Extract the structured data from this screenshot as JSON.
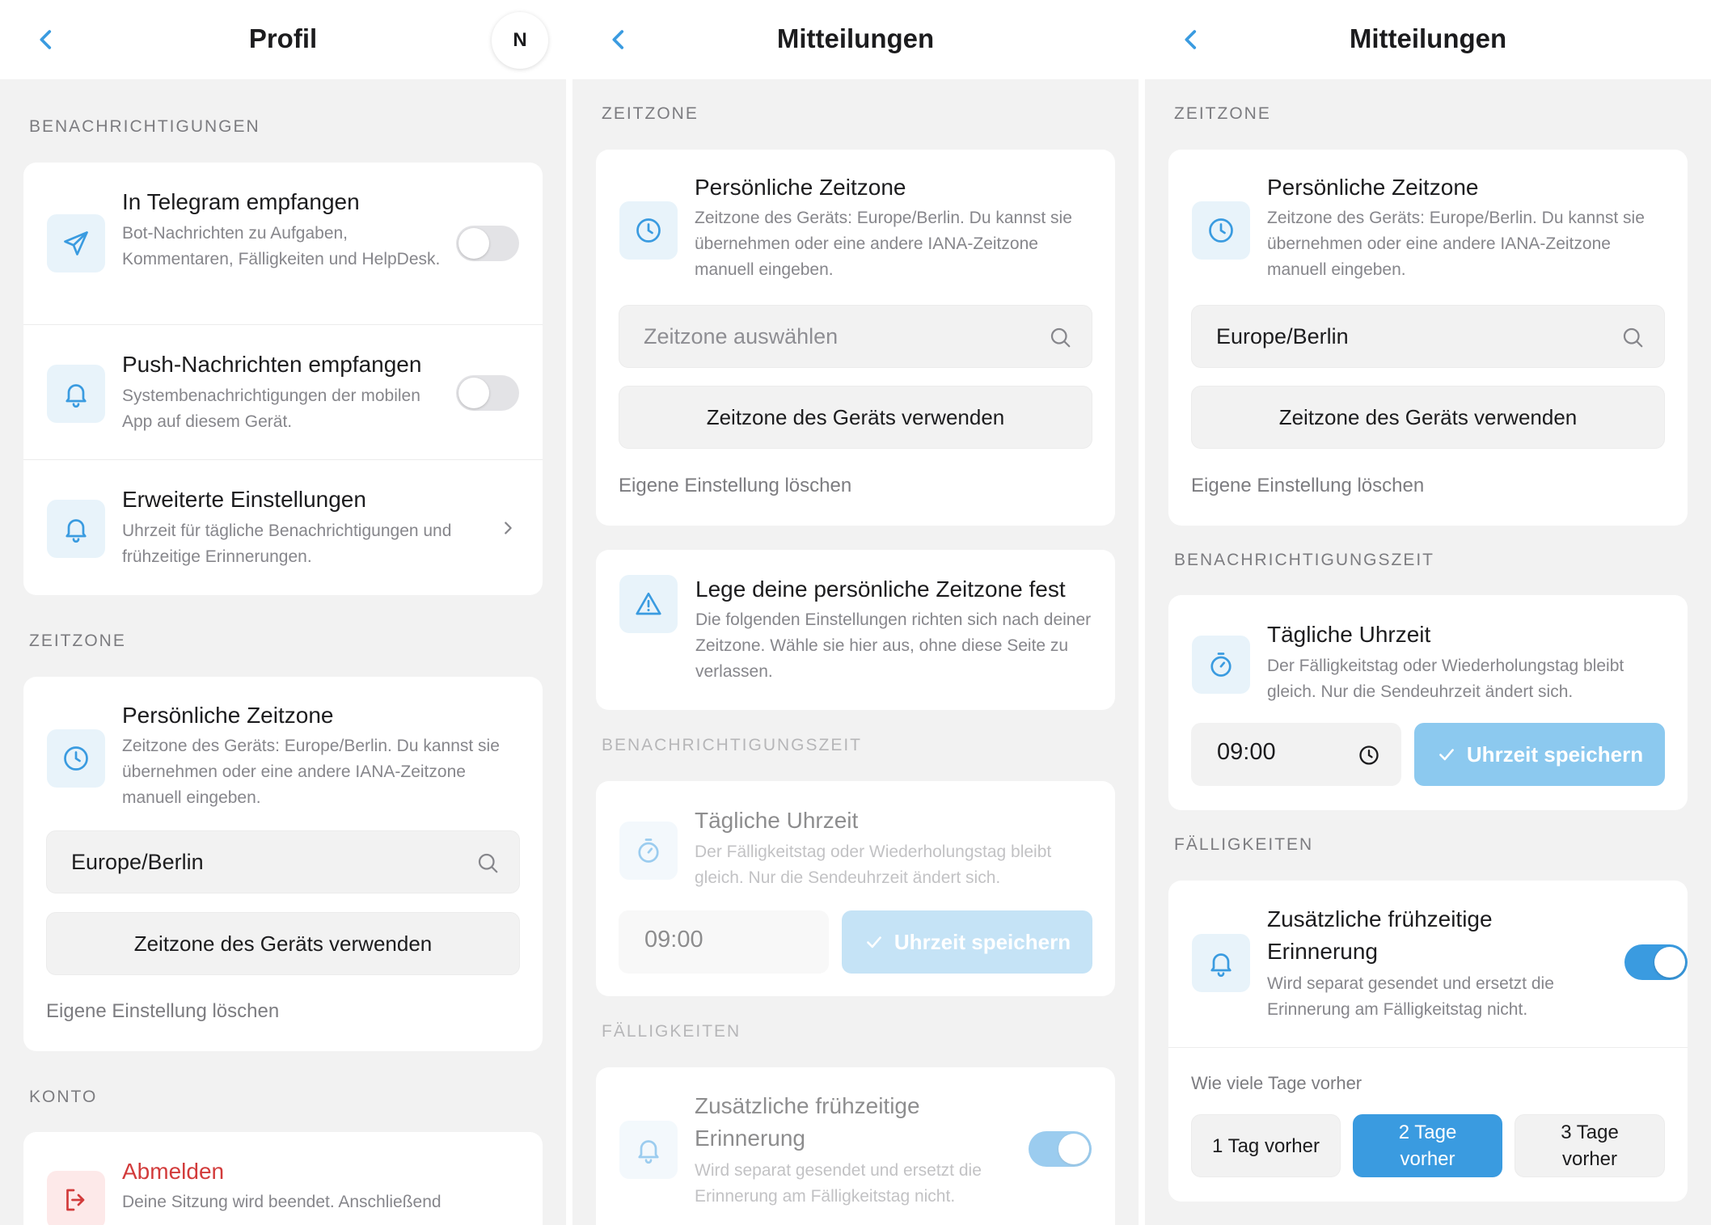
{
  "colors": {
    "accent": "#3a9be0",
    "accent_light": "#8cc9ef",
    "icon_bg": "#e8f3fa",
    "danger": "#d23b3b"
  },
  "panel1": {
    "title": "Profil",
    "avatar_initial": "N",
    "sec_notifications": "BENACHRICHTIGUNGEN",
    "telegram": {
      "title": "In Telegram empfangen",
      "desc": "Bot-Nachrichten zu Aufgaben, Kommentaren, Fälligkeiten und HelpDesk.",
      "icon": "send-icon",
      "enabled": false
    },
    "push": {
      "title": "Push-Nachrichten empfangen",
      "desc": "Systembenachrichtigungen der mobilen App auf diesem Gerät.",
      "icon": "bell-icon",
      "enabled": false
    },
    "advanced": {
      "title": "Erweiterte Einstellungen",
      "desc": "Uhrzeit für tägliche Benachrichtigungen und frühzeitige Erinnerungen.",
      "icon": "bell-icon"
    },
    "sec_timezone": "ZEITZONE",
    "timezone": {
      "title": "Persönliche Zeitzone",
      "desc": "Zeitzone des Geräts: Europe/Berlin. Du kannst sie übernehmen oder eine andere IANA-Zeitzone manuell eingeben.",
      "value": "Europe/Berlin",
      "use_device": "Zeitzone des Geräts verwenden",
      "clear": "Eigene Einstellung löschen"
    },
    "sec_account": "KONTO",
    "logout": {
      "title": "Abmelden",
      "desc": "Deine Sitzung wird beendet. Anschließend"
    }
  },
  "panel2": {
    "title": "Mitteilungen",
    "sec_timezone": "ZEITZONE",
    "timezone": {
      "title": "Persönliche Zeitzone",
      "desc": "Zeitzone des Geräts: Europe/Berlin. Du kannst sie übernehmen oder eine andere IANA-Zeitzone manuell eingeben.",
      "placeholder": "Zeitzone auswählen",
      "use_device": "Zeitzone des Geräts verwenden",
      "clear": "Eigene Einstellung löschen"
    },
    "warning": {
      "title": "Lege deine persönliche Zeitzone fest",
      "desc": "Die folgenden Einstellungen richten sich nach deiner Zeitzone. Wähle sie hier aus, ohne diese Seite zu verlassen."
    },
    "sec_time": "BENACHRICHTIGUNGSZEIT",
    "daily": {
      "title": "Tägliche Uhrzeit",
      "desc": "Der Fälligkeitstag oder Wiederholungstag bleibt gleich. Nur die Sendeuhrzeit ändert sich.",
      "time": "09:00",
      "save": "Uhrzeit speichern"
    },
    "sec_due": "FÄLLIGKEITEN",
    "early": {
      "title": "Zusätzliche frühzeitige Erinnerung",
      "desc": "Wird separat gesendet und ersetzt die Erinnerung am Fälligkeitstag nicht.",
      "enabled": true
    }
  },
  "panel3": {
    "title": "Mitteilungen",
    "sec_timezone": "ZEITZONE",
    "timezone": {
      "title": "Persönliche Zeitzone",
      "desc": "Zeitzone des Geräts: Europe/Berlin. Du kannst sie übernehmen oder eine andere IANA-Zeitzone manuell eingeben.",
      "value": "Europe/Berlin",
      "use_device": "Zeitzone des Geräts verwenden",
      "clear": "Eigene Einstellung löschen"
    },
    "sec_time": "BENACHRICHTIGUNGSZEIT",
    "daily": {
      "title": "Tägliche Uhrzeit",
      "desc": "Der Fälligkeitstag oder Wiederholungstag bleibt gleich. Nur die Sendeuhrzeit ändert sich.",
      "time": "09:00",
      "save": "Uhrzeit speichern"
    },
    "sec_due": "FÄLLIGKEITEN",
    "early": {
      "title": "Zusätzliche frühzeitige Erinnerung",
      "desc": "Wird separat gesendet und ersetzt die Erinnerung am Fälligkeitstag nicht.",
      "enabled": true
    },
    "days_label": "Wie viele Tage vorher",
    "days_options": [
      "1 Tag vorher",
      "2 Tage vorher",
      "3 Tage vorher"
    ],
    "days_selected": "2 Tage vorher"
  }
}
